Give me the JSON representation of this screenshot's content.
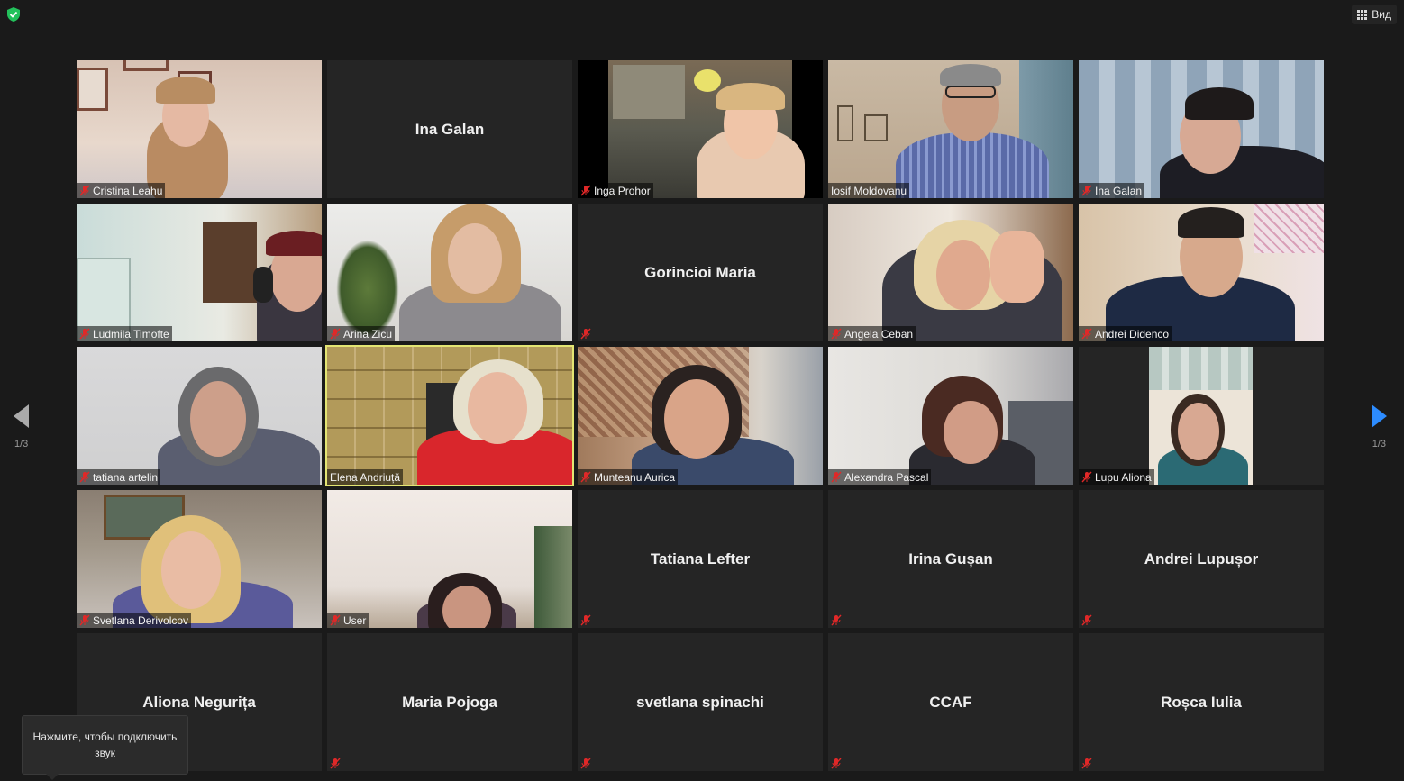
{
  "topbar": {
    "view_label": "Вид"
  },
  "pagination": {
    "left": "1/3",
    "right": "1/3"
  },
  "tooltip": {
    "text": "Нажмите, чтобы подключить звук"
  },
  "colors": {
    "active_border": "#e3e573",
    "nav_arrow_left": "#aaaaaa",
    "nav_arrow_right": "#2d8cff",
    "mic_muted": "#e02828",
    "shield": "#23c15b"
  },
  "participants": [
    {
      "name": "Cristina Leahu",
      "video": true,
      "muted": true
    },
    {
      "name": "Ina Galan",
      "video": false,
      "muted": false,
      "show_label": false
    },
    {
      "name": "Inga Prohor",
      "video": true,
      "muted": true
    },
    {
      "name": "Iosif Moldovanu",
      "video": true,
      "muted": false
    },
    {
      "name": "Ina Galan",
      "video": true,
      "muted": true
    },
    {
      "name": "Ludmila Timofte",
      "video": true,
      "muted": true
    },
    {
      "name": "Arina Zicu",
      "video": true,
      "muted": true
    },
    {
      "name": "Gorincioi Maria",
      "video": false,
      "muted": true
    },
    {
      "name": "Angela Ceban",
      "video": true,
      "muted": true
    },
    {
      "name": "Andrei Didenco",
      "video": true,
      "muted": true
    },
    {
      "name": "tatiana artelin",
      "video": true,
      "muted": true
    },
    {
      "name": "Elena Andriuță",
      "video": true,
      "muted": false,
      "active": true
    },
    {
      "name": "Munteanu Aurica",
      "video": true,
      "muted": true
    },
    {
      "name": "Alexandra Pascal",
      "video": true,
      "muted": true
    },
    {
      "name": "Lupu Aliona",
      "video": true,
      "muted": true
    },
    {
      "name": "Svetlana Derivolcov",
      "video": true,
      "muted": true
    },
    {
      "name": "User",
      "video": true,
      "muted": true
    },
    {
      "name": "Tatiana Lefter",
      "video": false,
      "muted": true
    },
    {
      "name": "Irina Gușan",
      "video": false,
      "muted": true
    },
    {
      "name": "Andrei Lupușor",
      "video": false,
      "muted": true
    },
    {
      "name": "Aliona Negurița",
      "video": false,
      "muted": true
    },
    {
      "name": "Maria Pojoga",
      "video": false,
      "muted": true
    },
    {
      "name": "svetlana spinachi",
      "video": false,
      "muted": true
    },
    {
      "name": "CCAF",
      "video": false,
      "muted": true
    },
    {
      "name": "Roșca Iulia",
      "video": false,
      "muted": true
    }
  ]
}
